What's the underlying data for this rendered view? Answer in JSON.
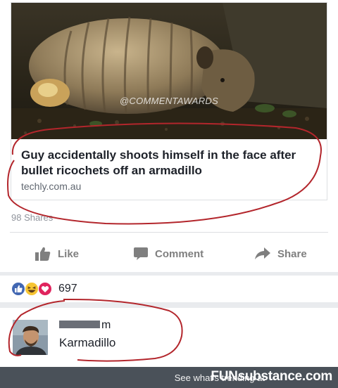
{
  "post": {
    "watermark": "@COMMENTAWARDS",
    "link_title": "Guy accidentally shoots himself in the face after bullet ricochets off an armadillo",
    "link_domain": "techly.com.au",
    "shares_text": "98 Shares"
  },
  "actions": {
    "like_label": "Like",
    "comment_label": "Comment",
    "share_label": "Share"
  },
  "reactions": {
    "icons": [
      "like-icon",
      "haha-icon",
      "love-icon"
    ],
    "count": "697"
  },
  "comment": {
    "name_suffix": "m",
    "text": "Karmadillo"
  },
  "footer": {
    "promo_text": "See what's trending at",
    "brand": "FUNsubstance.com"
  },
  "colors": {
    "annotation_red": "#b3262c",
    "facebook_blue": "#4267b2",
    "love_red": "#e0245e",
    "footer_bg": "#4a5159"
  }
}
